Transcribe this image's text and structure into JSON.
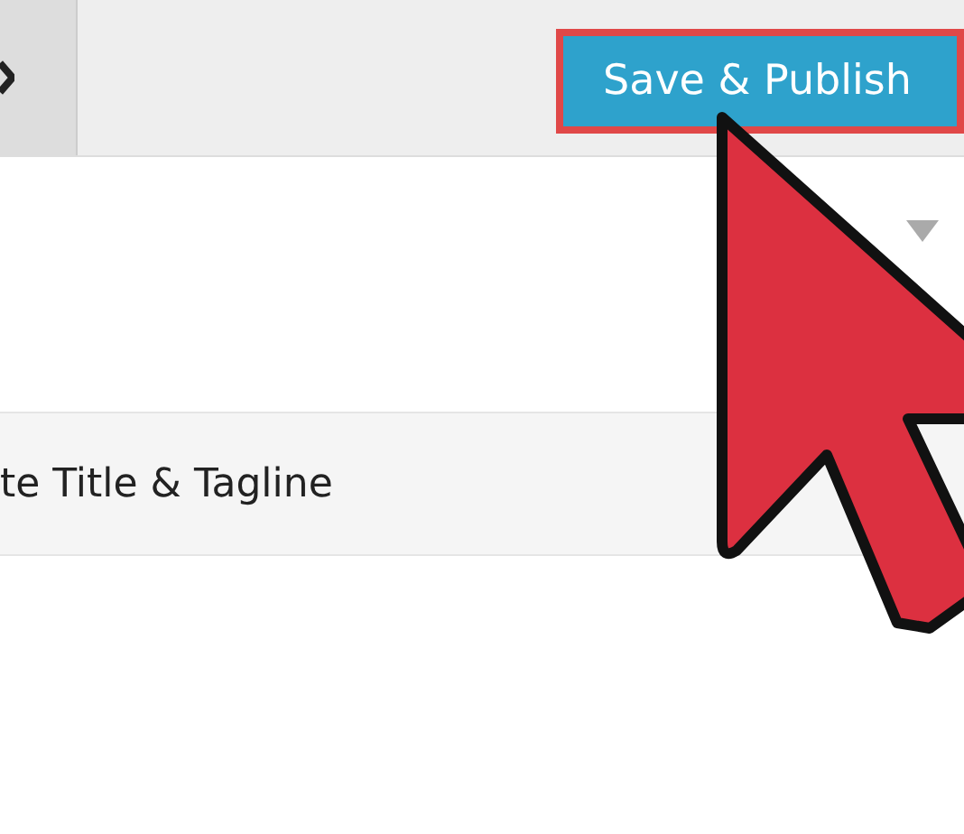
{
  "header": {
    "publish_button": {
      "label": "Save & Publish"
    }
  },
  "panel": {
    "sections": [
      {
        "title": "te Title & Tagline"
      }
    ]
  }
}
